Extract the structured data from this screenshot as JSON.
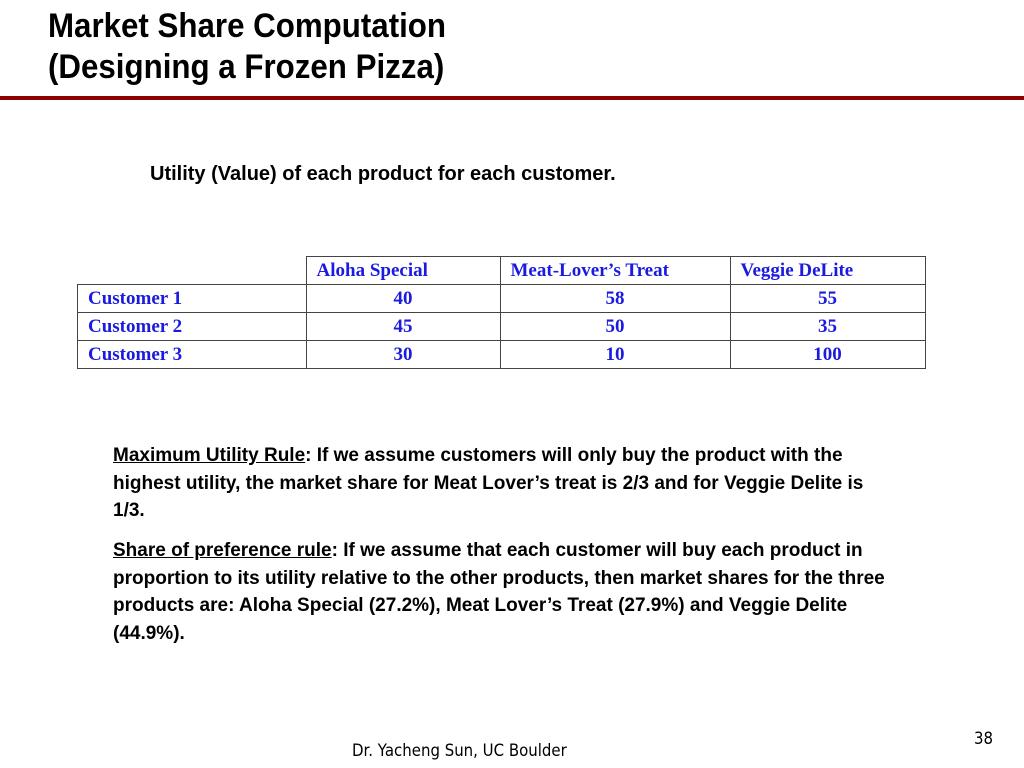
{
  "slide": {
    "title_line1": "Market Share Computation",
    "title_line2": "(Designing a Frozen Pizza)",
    "accent_color": "#8b0000",
    "subtitle": "Utility (Value) of each product for each customer.",
    "table": {
      "columns": [
        "",
        "Aloha Special",
        "Meat-Lover’s Treat",
        "Veggie DeLite"
      ],
      "rows": [
        {
          "label": "Customer 1",
          "values": [
            "40",
            "58",
            "55"
          ]
        },
        {
          "label": "Customer 2",
          "values": [
            "45",
            "50",
            "35"
          ]
        },
        {
          "label": "Customer 3",
          "values": [
            "30",
            "10",
            "100"
          ]
        }
      ],
      "text_color": "#1a1ae0"
    },
    "paragraphs": [
      {
        "lead": "Maximum Utility Rule",
        "body": ": If we assume customers will only buy the product with the highest utility, the market share for Meat Lover’s treat is 2/3 and for Veggie Delite is 1/3."
      },
      {
        "lead": "Share of preference rule",
        "body": ": If we assume that each customer will buy each product in proportion to its utility relative to the other products, then market shares for the three products are:  Aloha Special (27.2%), Meat Lover’s Treat (27.9%) and Veggie Delite (44.9%)."
      }
    ],
    "footer": "Dr. Yacheng Sun, UC Boulder",
    "page_number": "38"
  }
}
